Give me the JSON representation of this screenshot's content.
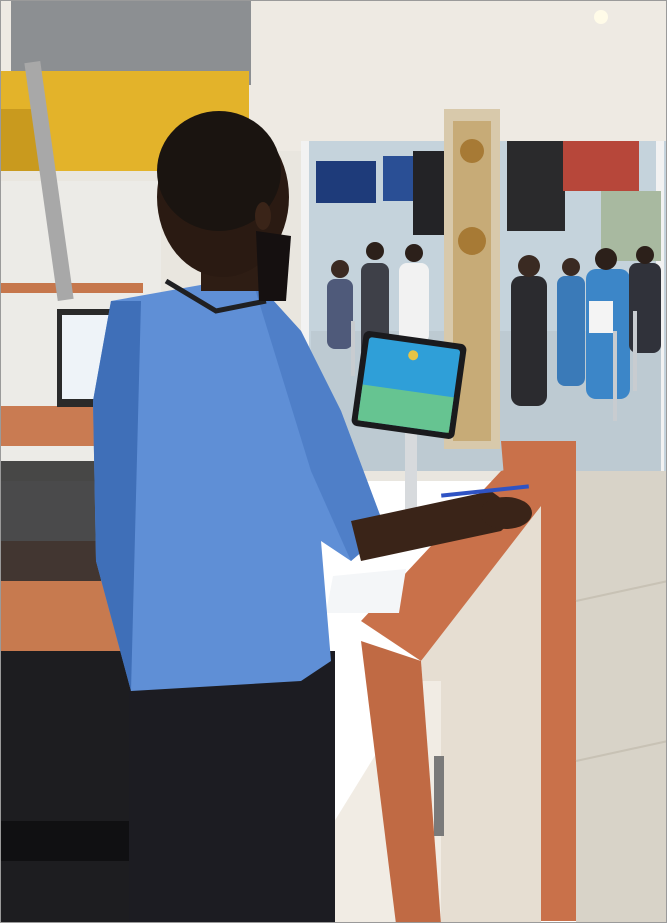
{
  "photo": {
    "kind": "photograph",
    "palette": {
      "shirt": "#5f8fd6",
      "shirt_shadow": "#3f6fb8",
      "skin": "#3a2418",
      "hair": "#1a1410",
      "trousers": "#1c1c22",
      "counter_wood": "#c9714a",
      "counter_panel": "#e6ded2",
      "ceiling": "#eeeae3",
      "yellow_sign": "#e3b32a",
      "floor": "#d8d3c8",
      "glass": "#c5d3dc",
      "tablet_screen": "#2f9fd8",
      "pillar": "#d8c9ab"
    }
  }
}
